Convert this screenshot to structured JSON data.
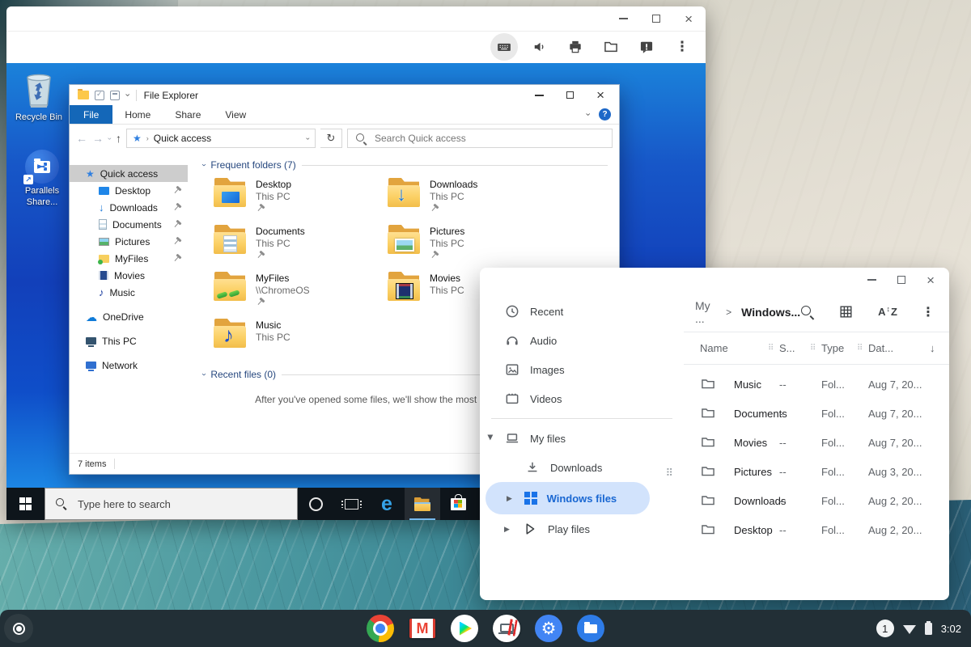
{
  "parallels_window": {
    "toolbar_icons": [
      "keyboard",
      "volume",
      "print",
      "shared-folder",
      "report-problem",
      "menu"
    ]
  },
  "windows": {
    "desktop_icons": [
      {
        "label": "Recycle Bin"
      },
      {
        "label": "Parallels Share..."
      }
    ],
    "taskbar": {
      "search_placeholder": "Type here to search"
    }
  },
  "file_explorer": {
    "title": "File Explorer",
    "tabs": [
      {
        "label": "File",
        "active": true
      },
      {
        "label": "Home"
      },
      {
        "label": "Share"
      },
      {
        "label": "View"
      }
    ],
    "address": {
      "location": "Quick access"
    },
    "search_placeholder": "Search Quick access",
    "sidebar": [
      {
        "label": "Quick access",
        "selected": true
      },
      {
        "label": "Desktop",
        "pinned": true
      },
      {
        "label": "Downloads",
        "pinned": true
      },
      {
        "label": "Documents",
        "pinned": true
      },
      {
        "label": "Pictures",
        "pinned": true
      },
      {
        "label": "MyFiles",
        "pinned": true
      },
      {
        "label": "Movies"
      },
      {
        "label": "Music"
      },
      {
        "label": "OneDrive"
      },
      {
        "label": "This PC"
      },
      {
        "label": "Network"
      }
    ],
    "sections": {
      "frequent": {
        "header": "Frequent folders (7)"
      },
      "recent": {
        "header": "Recent files (0)",
        "empty_message": "After you've opened some files, we'll show the most recent ones here."
      }
    },
    "frequent_folders": [
      {
        "name": "Desktop",
        "location": "This PC",
        "pinned": true
      },
      {
        "name": "Downloads",
        "location": "This PC",
        "pinned": true
      },
      {
        "name": "Documents",
        "location": "This PC",
        "pinned": true
      },
      {
        "name": "Pictures",
        "location": "This PC",
        "pinned": true
      },
      {
        "name": "MyFiles",
        "location": "\\\\ChromeOS",
        "pinned": true
      },
      {
        "name": "Movies",
        "location": "This PC"
      },
      {
        "name": "Music",
        "location": "This PC"
      }
    ],
    "status_bar": {
      "items_count": "7 items"
    }
  },
  "files_app": {
    "breadcrumb": {
      "parent": "My ...",
      "separator": ">",
      "current": "Windows..."
    },
    "nav": [
      {
        "label": "Recent"
      },
      {
        "label": "Audio"
      },
      {
        "label": "Images"
      },
      {
        "label": "Videos"
      },
      {
        "label": "My files",
        "expanded": true
      },
      {
        "label": "Downloads",
        "child": true
      },
      {
        "label": "Windows files",
        "child": true,
        "selected": true
      },
      {
        "label": "Play files",
        "child": true
      }
    ],
    "table": {
      "columns": {
        "name": "Name",
        "size": "S...",
        "type": "Type",
        "date": "Dat..."
      },
      "rows": [
        {
          "name": "Music",
          "size": "--",
          "type": "Fol...",
          "date": "Aug 7, 20..."
        },
        {
          "name": "Documents",
          "size": "--",
          "type": "Fol...",
          "date": "Aug 7, 20..."
        },
        {
          "name": "Movies",
          "size": "--",
          "type": "Fol...",
          "date": "Aug 7, 20..."
        },
        {
          "name": "Pictures",
          "size": "--",
          "type": "Fol...",
          "date": "Aug 3, 20..."
        },
        {
          "name": "Downloads",
          "size": "--",
          "type": "Fol...",
          "date": "Aug 2, 20..."
        },
        {
          "name": "Desktop",
          "size": "--",
          "type": "Fol...",
          "date": "Aug 2, 20..."
        }
      ]
    }
  },
  "shelf": {
    "apps": [
      "chrome",
      "gmail",
      "play-store",
      "parallels-desktop",
      "settings",
      "files"
    ],
    "status": {
      "notification_count": "1",
      "time": "3:02"
    }
  },
  "colors": {
    "accent_blue": "#1a73e8",
    "files_selection_pill": "#d2e3fc",
    "files_selected_text": "#1967d2",
    "explorer_file_tab": "#1467b8",
    "windows_desktop_blue": "#1240ba",
    "windows_taskbar": "#0e151b",
    "shelf_background": "#222f36"
  }
}
